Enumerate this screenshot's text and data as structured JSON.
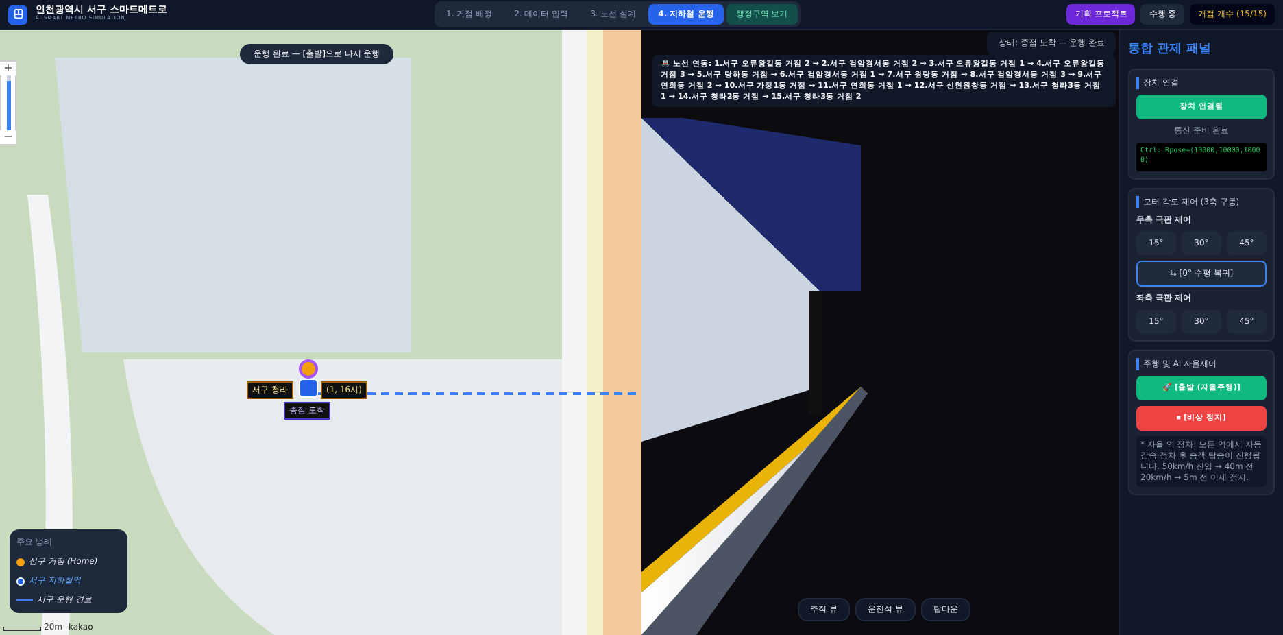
{
  "app": {
    "title": "인천광역시 서구 스마트메트로",
    "subtitle": "AI SMART METRO SIMULATION"
  },
  "steps": [
    {
      "label": "1. 거점 배정",
      "selected": false
    },
    {
      "label": "2. 데이터 입력",
      "selected": false
    },
    {
      "label": "3. 노선 설계",
      "selected": false
    },
    {
      "label": "4. 지하철 운행",
      "selected": true
    },
    {
      "label": "행정구역 보기",
      "selected": false
    }
  ],
  "header_buttons": [
    {
      "kind": "project",
      "label": "기획 프로젝트"
    },
    {
      "kind": "run",
      "label": "수행 중"
    },
    {
      "kind": "count",
      "label": "거점 개수 (15/15)"
    }
  ],
  "map": {
    "toast": "운행 완료 — [출발]으로 다시 운행",
    "marker_label": "서구 청라",
    "marker_reading": "(1, 16시)",
    "marker_status": "종점 도착",
    "zoom_in": "+",
    "zoom_out": "−",
    "zoom_slider": {
      "level": 0.9
    },
    "legend": {
      "title": "주요 범례",
      "items": [
        {
          "kind": "home",
          "label": "선구 거점 (Home)",
          "color": "#f59e0b"
        },
        {
          "kind": "station",
          "label": "서구 지하철역",
          "color": "#2563eb"
        },
        {
          "kind": "route",
          "label": "서구 운행 경로",
          "color": "#3b82f6"
        }
      ]
    },
    "scale": "20m",
    "attribution": "kakao"
  },
  "view": {
    "status": "상태: 종점 도착 — 운행 완료",
    "route": "🚇 노선 연동: 1.서구 오류왕길동 거점 2 → 2.서구 검암경서동 거점 2 → 3.서구 오류왕길동 거점 1 → 4.서구 오류왕길동 거점 3 → 5.서구 당하동 거점 → 6.서구 검암경서동 거점 1 → 7.서구 원당동 거점 → 8.서구 검암경서동 거점 3 → 9.서구 연희동 거점 2 → 10.서구 가정1동 거점 → 11.서구 연희동 거점 1 → 12.서구 신현원창동 거점 → 13.서구 청라3동 거점 1 → 14.서구 청라2동 거점 → 15.서구 청라3동 거점 2",
    "cameras": [
      {
        "label": "추적 뷰",
        "selected": false
      },
      {
        "label": "운전석 뷰",
        "selected": false
      },
      {
        "label": "탑다운",
        "selected": false
      }
    ]
  },
  "panel": {
    "title": "통합 관제 패널",
    "device": {
      "title": "장치 연결",
      "button": "장치 연결됨",
      "connected": true,
      "status": "통신 준비 완료",
      "log": "Ctrl: Rpose=(10000,10000,10000)"
    },
    "motor": {
      "title": "모터 각도 제어 (3축 구동)",
      "right_label": "우측 극판 제어",
      "right_angles": [
        "15°",
        "30°",
        "45°"
      ],
      "reset": "⇆ [0° 수평 복귀]",
      "left_label": "좌측 극판 제어",
      "left_angles": [
        "15°",
        "30°",
        "45°"
      ]
    },
    "drive": {
      "title": "주행 및 AI 자율제어",
      "start": "🚀 [출발 (자율주행)]",
      "stop": "⏹ [비상 정지]",
      "note": "* 자율 역 정차: 모든 역에서 자동 감속·정차 후 승객 탑승이 진행됩니다. 50km/h 진입 → 40m 전 20km/h → 5m 전 이세 정지."
    }
  }
}
